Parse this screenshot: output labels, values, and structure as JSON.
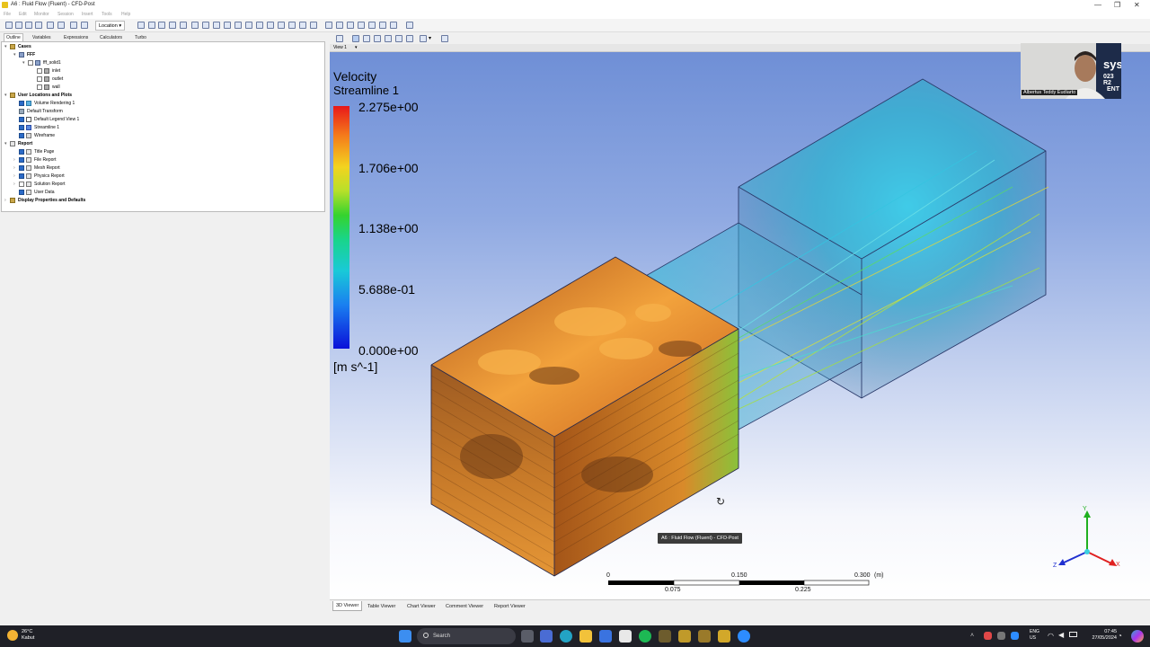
{
  "window": {
    "title": "A6 : Fluid Flow (Fluent) - CFD-Post",
    "controls": [
      "—",
      "❐",
      "✕"
    ]
  },
  "menu": [
    "File",
    "Edit",
    "Monitor",
    "Session",
    "Insert",
    "Tools",
    "Help"
  ],
  "toolbar": {
    "location_label": "Location"
  },
  "panel_tabs": [
    "Outline",
    "Variables",
    "Expressions",
    "Calculators",
    "Turbo"
  ],
  "tree": {
    "cases": "Cases",
    "fff": "FFF",
    "fff_solid": "fff_solid1",
    "inlet": "inlet",
    "outlet": "outlet",
    "wall": "wall",
    "user_locations": "User Locations and Plots",
    "volume_rendering": "Volume Rendering 1",
    "default_transform": "Default Transform",
    "default_legend": "Default Legend View 1",
    "streamline": "Streamline 1",
    "wireframe": "Wireframe",
    "report": "Report",
    "title_page": "Title Page",
    "file_report": "File Report",
    "mesh_report": "Mesh Report",
    "physics_report": "Physics Report",
    "solution_report": "Solution Report",
    "user_data": "User Data",
    "display_props": "Display Properties and Defaults"
  },
  "view": {
    "label": "View 1"
  },
  "legend": {
    "variable": "Velocity",
    "object": "Streamline 1",
    "values": [
      "2.275e+00",
      "1.706e+00",
      "1.138e+00",
      "5.688e-01",
      "0.000e+00"
    ],
    "unit": "[m s^-1]"
  },
  "scale": {
    "top": [
      "0",
      "0.150",
      "0.300",
      "(m)"
    ],
    "bottom": [
      "0.075",
      "0.225"
    ]
  },
  "axes": {
    "x": "X",
    "y": "Y",
    "z": "Z",
    "x_color": "#e02020",
    "y_color": "#20b020",
    "z_color": "#2030d0"
  },
  "tooltip": "A6 : Fluid Flow (Fluent) - CFD-Post",
  "webcam": {
    "name": "Albertus Teddy Eudiarto",
    "brand_text": "sys",
    "version_text": "023 R2",
    "suffix_text": "ENT"
  },
  "bottom_tabs": [
    "3D Viewer",
    "Table Viewer",
    "Chart Viewer",
    "Comment Viewer",
    "Report Viewer"
  ],
  "taskbar": {
    "temperature": "26°C",
    "weather": "Kabut",
    "search": "Search",
    "lang_top": "ENG",
    "lang_bottom": "US",
    "time": "07:45",
    "date": "27/05/2024"
  }
}
